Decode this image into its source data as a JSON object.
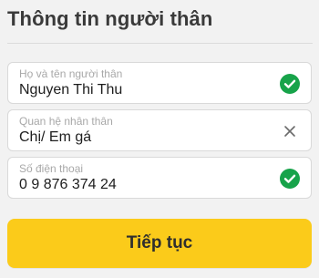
{
  "header": {
    "title": "Thông tin người thân"
  },
  "form": {
    "fields": [
      {
        "label": "Họ và tên người thân",
        "value": "Nguyen Thi Thu",
        "status_icon": "check-circle-icon",
        "status_color": "#17a34a"
      },
      {
        "label": "Quan hệ nhân thân",
        "value": "Chị/ Em gá",
        "status_icon": "close-icon",
        "status_color": "#6b6b6b"
      },
      {
        "label": "Số điện thoại",
        "value": "0 9 876 374 24",
        "status_icon": "check-circle-icon",
        "status_color": "#17a34a"
      }
    ]
  },
  "actions": {
    "continue_label": "Tiếp tục",
    "continue_color": "#fbcb1a"
  }
}
